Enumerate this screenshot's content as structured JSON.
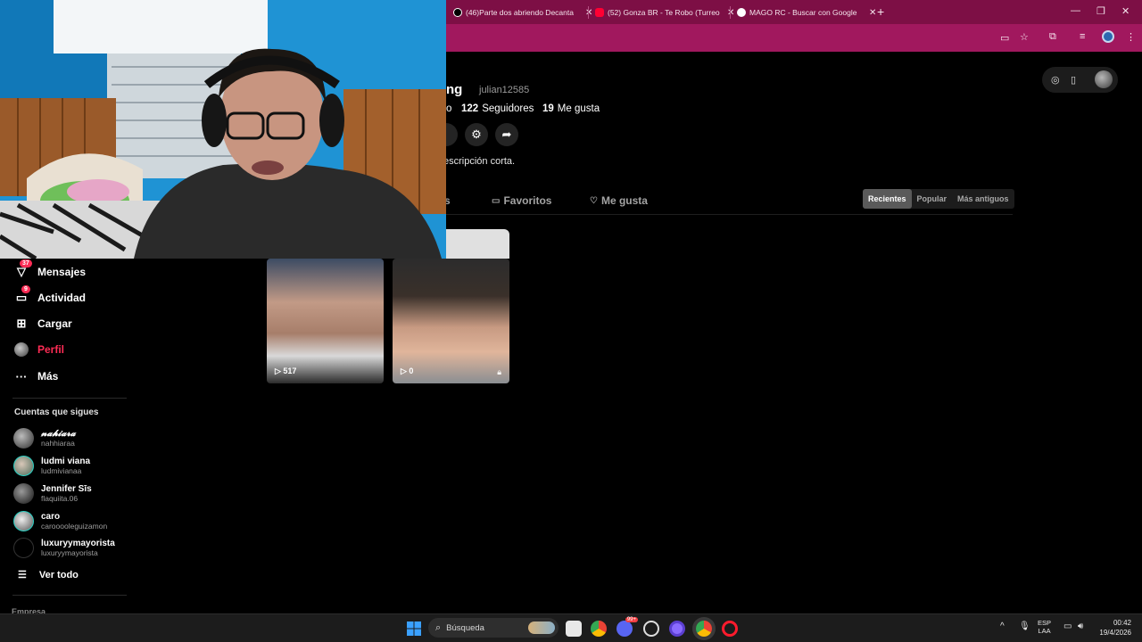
{
  "browser": {
    "tabs": [
      {
        "title": "(46)Parte dos abriendo Decanta",
        "favicon": "tiktok-icon",
        "color": "#000000"
      },
      {
        "title": "(52) Gonza BR - Te Robo (Turreo",
        "favicon": "youtube-icon",
        "color": "#ff0033"
      },
      {
        "title": "MAGO RC - Buscar con Google",
        "favicon": "google-icon",
        "color": "#ffffff"
      }
    ],
    "new_tab": "+",
    "window_controls": {
      "minimize": "—",
      "restore": "❐",
      "close": "✕"
    },
    "accent": "#7d0f45",
    "toolbar_color": "#a1185e"
  },
  "profile": {
    "name": "ng",
    "handle": "julian12585",
    "stats": [
      {
        "value": "",
        "label": "o"
      },
      {
        "value": "122",
        "label": "Seguidores"
      },
      {
        "value": "19",
        "label": "Me gusta"
      }
    ],
    "bio": "escripción corta.",
    "tabs": [
      {
        "label": "s",
        "icon": ""
      },
      {
        "label": "Favoritos",
        "icon": "bookmark-icon"
      },
      {
        "label": "Me gusta",
        "icon": "heart-icon"
      }
    ],
    "sort_options": [
      "Recientes",
      "Popular",
      "Más antiguos"
    ],
    "sort_selected": "Recientes"
  },
  "videos": [
    {
      "views": "517",
      "locked": false
    },
    {
      "views": "0",
      "locked": true
    }
  ],
  "sidebar": {
    "items": [
      {
        "label": "Mensajes",
        "icon": "messages-icon",
        "badge": "37"
      },
      {
        "label": "Actividad",
        "icon": "activity-icon",
        "badge": "9"
      },
      {
        "label": "Cargar",
        "icon": "upload-icon",
        "badge": ""
      },
      {
        "label": "Perfil",
        "icon": "profile-avatar-icon",
        "badge": ""
      },
      {
        "label": "Más",
        "icon": "more-icon",
        "badge": ""
      }
    ],
    "active_color": "#fe2c55",
    "following_title": "Cuentas que sigues",
    "following": [
      {
        "name": "𝓷𝓪𝓱𝓲𝓪𝓻𝓪",
        "handle": "nahhiaraa"
      },
      {
        "name": "ludmi viana",
        "handle": "ludmivianaa"
      },
      {
        "name": "Jennifer Sīs",
        "handle": "flaquiita.06"
      },
      {
        "name": "caro",
        "handle": "carooooleguizamon"
      },
      {
        "name": "luxuryymayorista",
        "handle": "luxuryymayorista"
      }
    ],
    "see_all": "Ver todo",
    "company": "Empresa"
  },
  "taskbar": {
    "search_placeholder": "Búsqueda",
    "lang_top": "ESP",
    "lang_bottom": "LAA",
    "time": "00:42",
    "date": "19/4/2026",
    "discord_badge": "99+"
  }
}
